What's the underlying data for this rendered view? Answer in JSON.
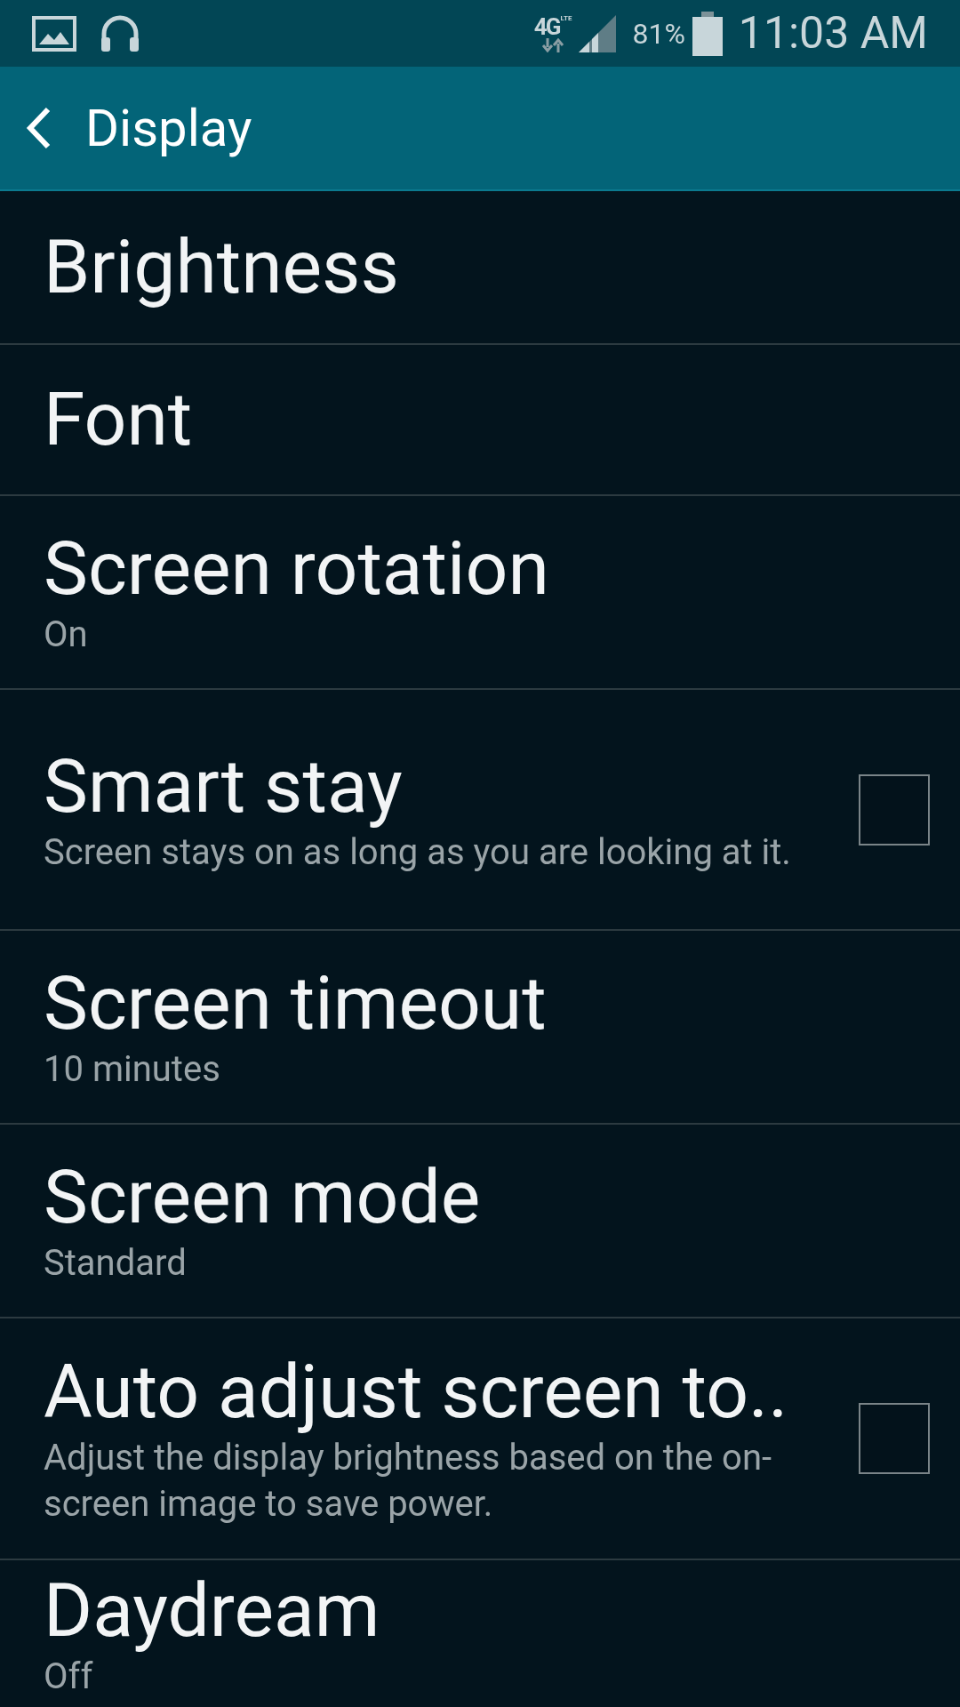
{
  "status_bar": {
    "network": "4G",
    "network_sub": "LTE",
    "battery": "81%",
    "time": "11:03 AM"
  },
  "header": {
    "title": "Display"
  },
  "settings": [
    {
      "kind": "plain",
      "title": "Brightness"
    },
    {
      "kind": "plain",
      "title": "Font"
    },
    {
      "kind": "plain",
      "title": "Screen rotation",
      "summary": "On"
    },
    {
      "kind": "checkbox",
      "title": "Smart stay",
      "summary": "Screen stays on as long as you are looking at it.",
      "checked": false
    },
    {
      "kind": "plain",
      "title": "Screen timeout",
      "summary": "10 minutes"
    },
    {
      "kind": "plain",
      "title": "Screen mode",
      "summary": "Standard"
    },
    {
      "kind": "checkbox",
      "title": "Auto adjust screen to..",
      "summary": "Adjust the display brightness based on the on-screen image to save power.",
      "checked": false
    },
    {
      "kind": "plain",
      "title": "Daydream",
      "summary": "Off"
    }
  ]
}
